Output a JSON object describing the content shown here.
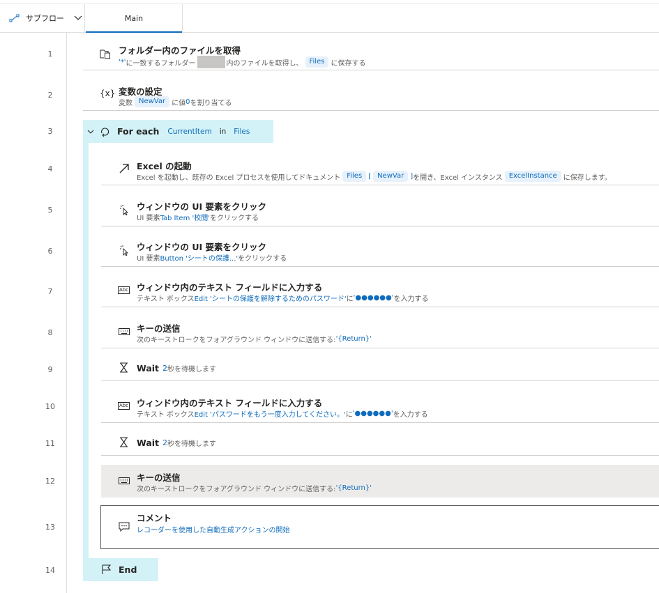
{
  "header": {
    "subflow_label": "サブフロー",
    "tab_main": "Main"
  },
  "line_numbers": [
    "1",
    "2",
    "3",
    "4",
    "5",
    "6",
    "7",
    "8",
    "9",
    "10",
    "11",
    "12",
    "13",
    "14"
  ],
  "actions": {
    "a1": {
      "title": "フォルダー内のファイルを取得",
      "d1": "'*'",
      "d2": " に一致するフォルダー",
      "d3": "内のファイルを取得し、",
      "pill": "Files",
      "d4": " に保存する"
    },
    "a2": {
      "title": "変数の設定",
      "d1": "変数 ",
      "pill1": "NewVar",
      "d2": " に値 ",
      "val": "0",
      "d3": " を割り当てる"
    },
    "a3": {
      "title": "For each",
      "pill1": "CurrentItem",
      "in": "in",
      "pill2": "Files"
    },
    "a4": {
      "title": "Excel の起動",
      "d1": "Excel を起動し、既存の Excel プロセスを使用してドキュメント ",
      "pill1": "Files",
      "br1": "[",
      "pill2": "NewVar",
      "br2": "]",
      "d2": " を開き、Excel インスタンス ",
      "pill3": "ExcelInstance",
      "d3": " に保存します。"
    },
    "a5": {
      "title": "ウィンドウの UI 要素をクリック",
      "d1": "UI 要素 ",
      "link": "Tab Item '校閲'",
      "d2": " をクリックする"
    },
    "a6": {
      "title": "ウィンドウの UI 要素をクリック",
      "d1": "UI 要素 ",
      "link": "Button 'シートの保護...'",
      "d2": " をクリックする"
    },
    "a7": {
      "title": "ウィンドウ内のテキスト フィールドに入力する",
      "d1": "テキスト ボックス ",
      "link": "Edit 'シートの保護を解除するためのパスワード'",
      "d2": " に ",
      "pw": "'●●●●●●'",
      "d3": " を入力する"
    },
    "a8": {
      "title": "キーの送信",
      "d1": "次のキーストロークをフォアグラウンド ウィンドウに送信する: ",
      "link": "'{Return}'"
    },
    "a9": {
      "title": "Wait",
      "val": "2",
      "d1": " 秒を待機します"
    },
    "a10": {
      "title": "ウィンドウ内のテキスト フィールドに入力する",
      "d1": "テキスト ボックス ",
      "link": "Edit 'パスワードをもう一度入力してください。'",
      "d2": " に ",
      "pw": "'●●●●●●'",
      "d3": " を入力する"
    },
    "a11": {
      "title": "Wait",
      "val": "2",
      "d1": " 秒を待機します"
    },
    "a12": {
      "title": "キーの送信",
      "d1": "次のキーストロークをフォアグラウンド ウィンドウに送信する: ",
      "link": "'{Return}'"
    },
    "a13": {
      "title": "コメント",
      "d1": "レコーダーを使用した自動生成アクションの開始"
    },
    "a14": {
      "title": "End"
    }
  },
  "colors": {
    "accent": "#0f6cbd",
    "loop_bg": "#d3f2f7",
    "pill_bg": "#e6f1fb",
    "selected_bg": "#edebe9"
  }
}
